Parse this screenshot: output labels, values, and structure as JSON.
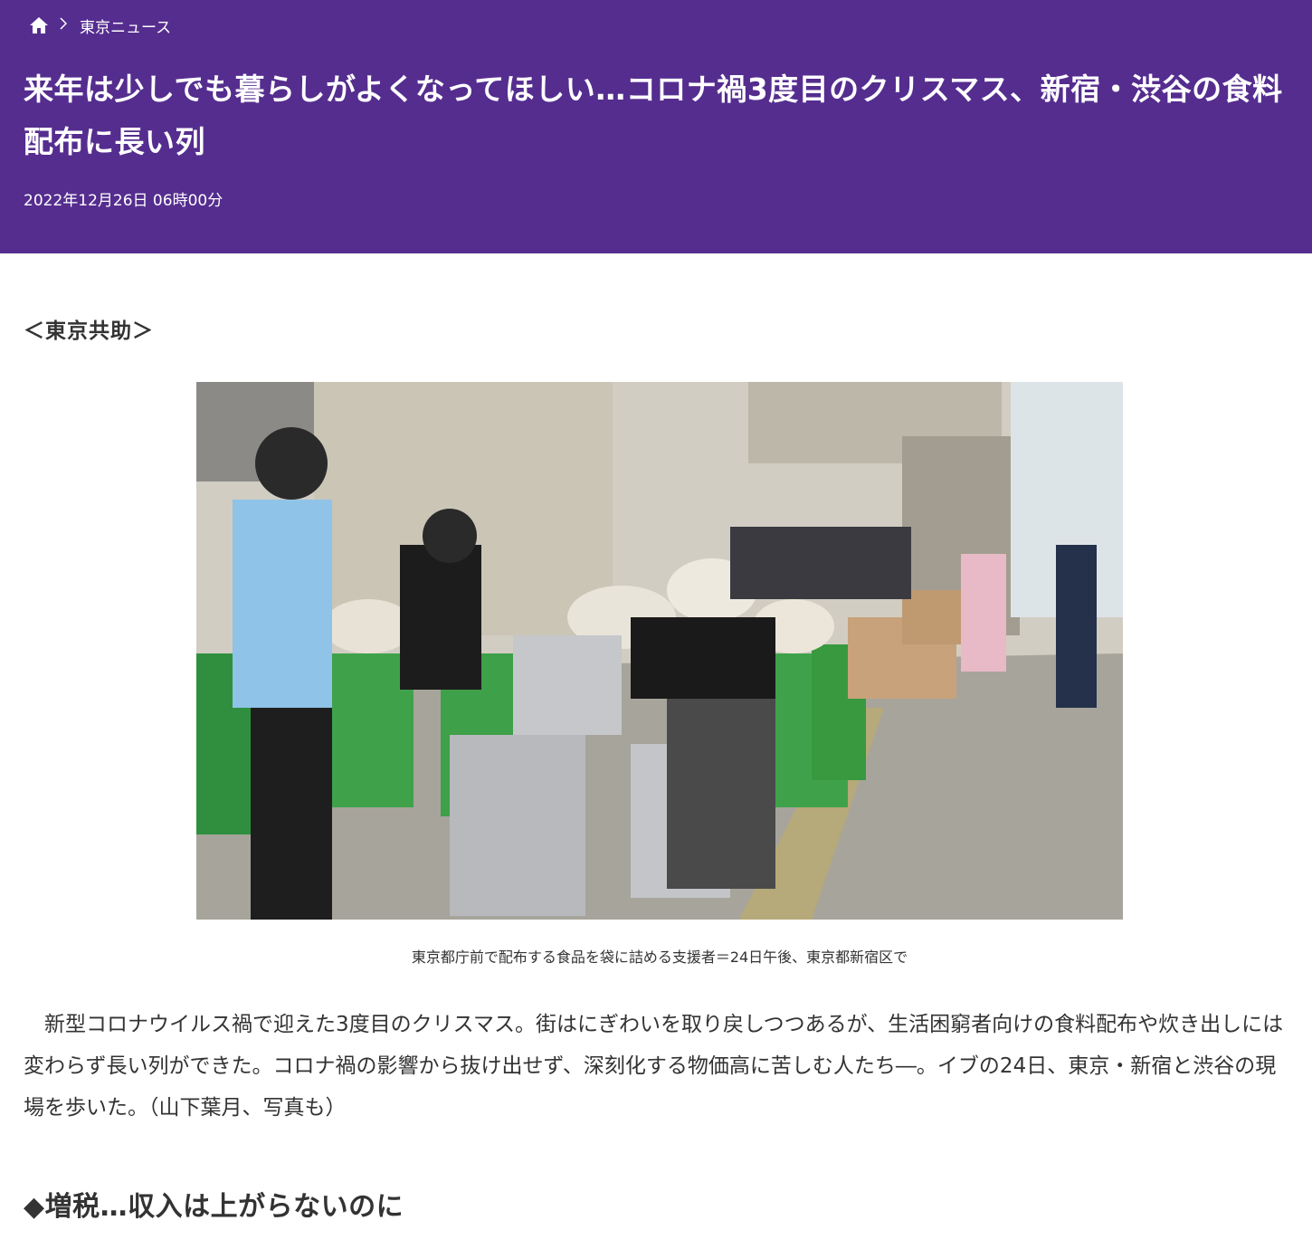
{
  "header": {
    "breadcrumb": {
      "home_icon": "home-icon",
      "separator_icon": "chevron-right-icon",
      "category": "東京ニュース"
    },
    "title": "来年は少しでも暮らしがよくなってほしい…コロナ禍3度目のクリスマス、新宿・渋谷の食料配布に長い列",
    "date": "2022年12月26日 06時00分",
    "background_color": "#552d8f"
  },
  "article": {
    "source": "＜東京共助＞",
    "photo": {
      "caption": "東京都庁前で配布する食品を袋に詰める支援者＝24日午後、東京都新宿区で"
    },
    "lead": "　新型コロナウイルス禍で迎えた3度目のクリスマス。街はにぎわいを取り戻しつつあるが、生活困窮者向けの食料配布や炊き出しには変わらず長い列ができた。コロナ禍の影響から抜け出せず、深刻化する物価高に苦しむ人たち―。イブの24日、東京・新宿と渋谷の現場を歩いた。（山下葉月、写真も）",
    "subheading": "◆増税…収入は上がらないのに"
  }
}
